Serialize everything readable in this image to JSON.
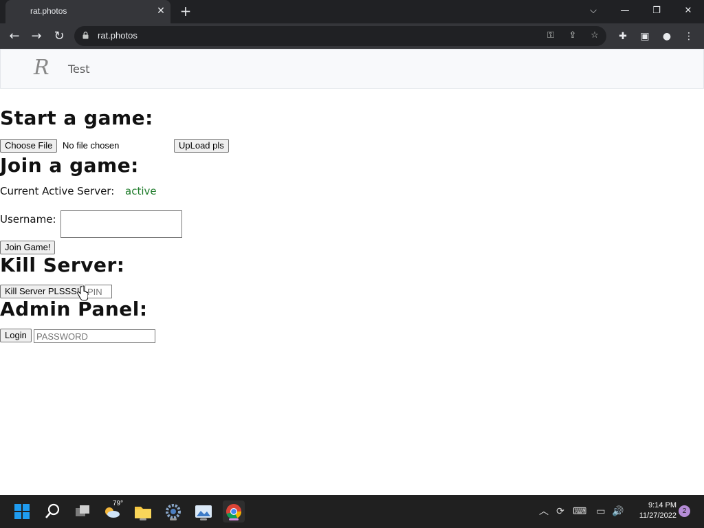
{
  "browser": {
    "tab_title": "rat.photos",
    "url": "rat.photos"
  },
  "site": {
    "logo_text": "R",
    "brand": "Test"
  },
  "start_game": {
    "heading": "Start a game:",
    "choose_file_label": "Choose File",
    "no_file_text": "No file chosen",
    "upload_label": "UpLoad pls"
  },
  "join_game": {
    "heading": "Join a game:",
    "server_label": "Current Active Server:",
    "server_status": "active",
    "username_label": "Username:",
    "username_value": "",
    "join_label": "Join Game!"
  },
  "kill_server": {
    "heading": "Kill Server:",
    "kill_label": "Kill Server PLSSS!",
    "pin_placeholder": "PIN"
  },
  "admin": {
    "heading": "Admin Panel:",
    "login_label": "Login",
    "password_placeholder": "PASSWORD"
  },
  "taskbar": {
    "weather_temp": "79°",
    "time": "9:14 PM",
    "date": "11/27/2022",
    "notification_count": "2"
  },
  "colors": {
    "status_active": "#1e7b2a",
    "chrome_dark": "#202124",
    "chrome_tab": "#35363a"
  }
}
